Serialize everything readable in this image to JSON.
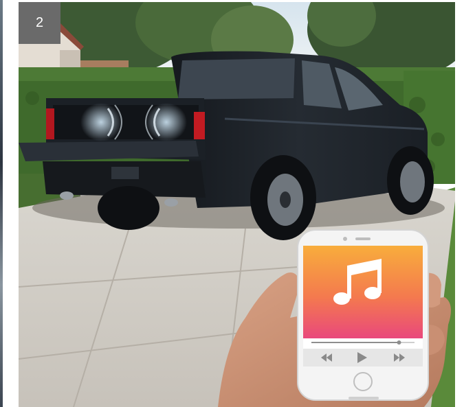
{
  "badge": {
    "number": "2"
  },
  "colors": {
    "truck": "#1d2228",
    "hedge": "#3f6a2c",
    "driveway": "#cfcac2",
    "phone_screen_top": "#f7a93a",
    "phone_screen_bottom": "#ea4c7a",
    "phone_body": "#f4f4f4"
  },
  "scene": {
    "subject": "truck-icon",
    "device": "smartphone-icon",
    "device_app_icon": "music-note-icon",
    "controls": [
      "rewind-icon",
      "play-icon",
      "fast-forward-icon"
    ],
    "playback_progress": 0.85
  }
}
